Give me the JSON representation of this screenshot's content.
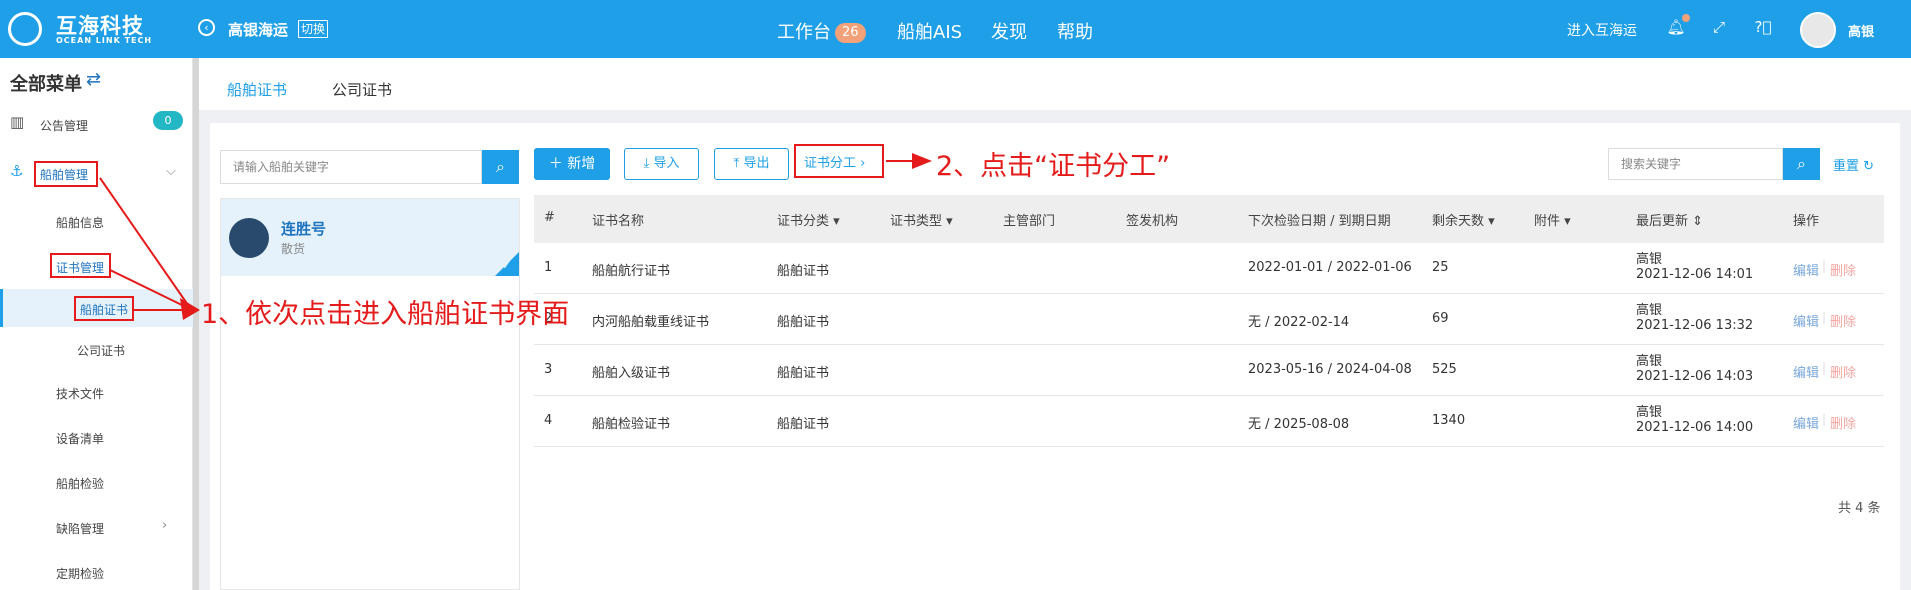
{
  "header": {
    "brand": "互海科技",
    "brand_sub": "OCEAN LINK TECH",
    "company": "高银海运",
    "switch": "切换",
    "nav": [
      {
        "label": "工作台",
        "badge": "26"
      },
      {
        "label": "船舶AIS"
      },
      {
        "label": "发现"
      },
      {
        "label": "帮助"
      }
    ],
    "enter": "进入互海运",
    "user": "高银"
  },
  "sidebar": {
    "title": "全部菜单",
    "badge": "0",
    "items": [
      "公告管理",
      "船舶管理",
      "船舶信息",
      "证书管理",
      "船舶证书",
      "公司证书",
      "技术文件",
      "设备清单",
      "船舶检验",
      "缺陷管理",
      "定期检验"
    ]
  },
  "tabs": [
    "船舶证书",
    "公司证书"
  ],
  "left_panel": {
    "search_placeholder": "请输入船舶关键字",
    "ship": {
      "name": "连胜号",
      "type": "散货"
    }
  },
  "toolbar": {
    "add": "新增",
    "import": "导入",
    "export": "导出",
    "division": "证书分工",
    "search_placeholder": "搜索关键字",
    "reset": "重置"
  },
  "annotations": {
    "step1": "1、依次点击进入船舶证书界面",
    "step2": "2、点击“证书分工”"
  },
  "table": {
    "columns": [
      "#",
      "证书名称",
      "证书分类",
      "证书类型",
      "主管部门",
      "签发机构",
      "下次检验日期 / 到期日期",
      "剩余天数",
      "附件",
      "最后更新",
      "操作"
    ],
    "rows": [
      {
        "no": "1",
        "name": "船舶航行证书",
        "category": "船舶证书",
        "dates": "2022-01-01 / 2022-01-06",
        "days": "25",
        "user": "高银",
        "updated": "2021-12-06 14:01"
      },
      {
        "no": "2",
        "name": "内河船舶载重线证书",
        "category": "船舶证书",
        "dates": "无 / 2022-02-14",
        "days": "69",
        "user": "高银",
        "updated": "2021-12-06 13:32"
      },
      {
        "no": "3",
        "name": "船舶入级证书",
        "category": "船舶证书",
        "dates": "2023-05-16 / 2024-04-08",
        "days": "525",
        "user": "高银",
        "updated": "2021-12-06 14:03"
      },
      {
        "no": "4",
        "name": "船舶检验证书",
        "category": "船舶证书",
        "dates": "无 / 2025-08-08",
        "days": "1340",
        "user": "高银",
        "updated": "2021-12-06 14:00"
      }
    ],
    "action_edit": "编辑",
    "action_delete": "删除",
    "total": "共 4 条"
  },
  "colors": {
    "primary": "#1e9fe8",
    "annotation": "#e51b1b"
  }
}
